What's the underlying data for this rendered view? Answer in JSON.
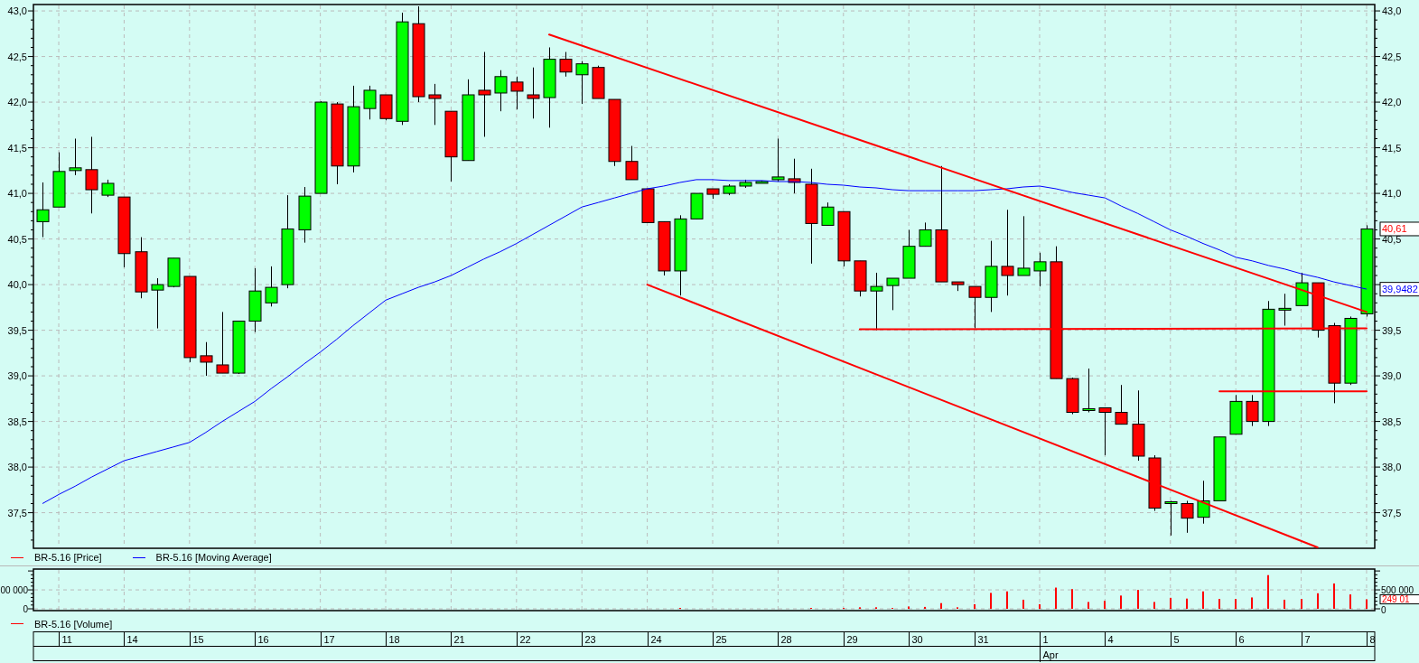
{
  "price_chart": {
    "chart_data": {
      "type": "candlestick",
      "grid": true,
      "ylim": [
        37.11,
        43.07
      ],
      "categories": [
        null,
        null,
        null,
        null,
        null,
        null,
        null,
        null,
        null,
        null,
        null,
        null,
        null,
        null,
        null,
        null,
        null,
        null,
        null,
        null,
        null,
        null,
        null,
        null,
        null,
        null,
        null,
        null,
        null,
        null,
        null,
        null,
        null,
        null,
        null,
        null,
        null,
        null,
        null,
        null,
        null,
        null,
        null,
        null,
        null,
        null,
        null,
        null,
        null,
        null,
        null,
        null,
        null,
        null,
        null,
        null,
        null,
        null,
        null,
        null,
        null,
        null,
        null,
        null,
        null,
        null,
        null,
        null,
        null,
        null,
        null,
        null,
        null,
        null,
        null,
        null,
        null,
        null,
        null,
        null,
        null,
        null
      ],
      "yticks": [
        {
          "value": 43,
          "label": "43,0"
        },
        {
          "value": 42.5,
          "label": "42,5"
        },
        {
          "value": 42,
          "label": "42,0"
        },
        {
          "value": 41.5,
          "label": "41,5"
        },
        {
          "value": 41,
          "label": "41,0"
        },
        {
          "value": 40.5,
          "label": "40,5"
        },
        {
          "value": 40,
          "label": "40,0"
        },
        {
          "value": 39.5,
          "label": "39,5"
        },
        {
          "value": 39,
          "label": "39,0"
        },
        {
          "value": 38.5,
          "label": "38,5"
        },
        {
          "value": 38,
          "label": "38,0"
        },
        {
          "value": 37.5,
          "label": "37,5"
        }
      ],
      "ohlc": [
        [
          40.69,
          41.12,
          40.52,
          40.82
        ],
        [
          40.85,
          41.45,
          40.85,
          41.24
        ],
        [
          41.25,
          41.6,
          41.2,
          41.28
        ],
        [
          41.26,
          41.62,
          40.78,
          41.04
        ],
        [
          40.98,
          41.15,
          40.96,
          41.11
        ],
        [
          40.96,
          40.96,
          40.19,
          40.34
        ],
        [
          40.36,
          40.52,
          39.85,
          39.92
        ],
        [
          39.94,
          40.07,
          39.52,
          40.0
        ],
        [
          39.98,
          40.29,
          39.97,
          40.29
        ],
        [
          40.09,
          40.09,
          39.15,
          39.2
        ],
        [
          39.22,
          39.37,
          39.0,
          39.15
        ],
        [
          39.12,
          39.7,
          39.03,
          39.03
        ],
        [
          39.03,
          39.6,
          39.02,
          39.6
        ],
        [
          39.6,
          40.18,
          39.48,
          39.93
        ],
        [
          39.8,
          40.2,
          39.76,
          39.97
        ],
        [
          40.0,
          40.98,
          39.96,
          40.61
        ],
        [
          40.6,
          41.07,
          40.46,
          40.97
        ],
        [
          41.0,
          42.01,
          41.0,
          42.0
        ],
        [
          41.98,
          42.0,
          41.1,
          41.3
        ],
        [
          41.3,
          42.18,
          41.23,
          41.95
        ],
        [
          41.93,
          42.18,
          41.81,
          42.13
        ],
        [
          42.08,
          42.08,
          41.8,
          41.82
        ],
        [
          41.79,
          42.98,
          41.75,
          42.88
        ],
        [
          42.86,
          43.05,
          42.0,
          42.06
        ],
        [
          42.08,
          42.2,
          41.75,
          42.04
        ],
        [
          41.9,
          41.9,
          41.13,
          41.4
        ],
        [
          41.36,
          42.25,
          41.36,
          42.08
        ],
        [
          42.13,
          42.55,
          41.62,
          42.08
        ],
        [
          42.1,
          42.35,
          41.9,
          42.28
        ],
        [
          42.22,
          42.28,
          41.92,
          42.12
        ],
        [
          42.08,
          42.38,
          41.82,
          42.04
        ],
        [
          42.05,
          42.6,
          41.72,
          42.47
        ],
        [
          42.47,
          42.55,
          42.28,
          42.33
        ],
        [
          42.3,
          42.45,
          41.98,
          42.42
        ],
        [
          42.38,
          42.4,
          42.04,
          42.04
        ],
        [
          42.03,
          42.03,
          41.3,
          41.35
        ],
        [
          41.35,
          41.52,
          41.15,
          41.15
        ],
        [
          41.05,
          41.05,
          40.68,
          40.68
        ],
        [
          40.69,
          40.69,
          40.1,
          40.15
        ],
        [
          40.15,
          40.76,
          39.88,
          40.72
        ],
        [
          40.72,
          41.0,
          40.72,
          41.0
        ],
        [
          41.05,
          41.05,
          40.94,
          40.99
        ],
        [
          41.0,
          41.1,
          40.98,
          41.08
        ],
        [
          41.08,
          41.15,
          41.06,
          41.12
        ],
        [
          41.13,
          41.14,
          41.12,
          41.13
        ],
        [
          41.15,
          41.6,
          41.13,
          41.18
        ],
        [
          41.16,
          41.38,
          41.0,
          41.12
        ],
        [
          41.1,
          41.27,
          40.23,
          40.67
        ],
        [
          40.65,
          40.9,
          40.65,
          40.85
        ],
        [
          40.8,
          40.8,
          40.2,
          40.26
        ],
        [
          40.26,
          40.26,
          39.87,
          39.93
        ],
        [
          39.93,
          40.13,
          39.5,
          39.98
        ],
        [
          39.99,
          40.07,
          39.72,
          40.07
        ],
        [
          40.07,
          40.6,
          40.07,
          40.42
        ],
        [
          40.42,
          40.68,
          40.42,
          40.6
        ],
        [
          40.6,
          41.3,
          40.03,
          40.03
        ],
        [
          40.03,
          40.03,
          39.93,
          40.0
        ],
        [
          39.98,
          39.98,
          39.52,
          39.86
        ],
        [
          39.86,
          40.48,
          39.7,
          40.2
        ],
        [
          40.2,
          40.82,
          39.88,
          40.1
        ],
        [
          40.1,
          40.75,
          40.1,
          40.18
        ],
        [
          40.15,
          40.35,
          39.98,
          40.25
        ],
        [
          40.25,
          40.42,
          38.97,
          38.97
        ],
        [
          38.97,
          38.98,
          38.58,
          38.6
        ],
        [
          38.62,
          39.08,
          38.6,
          38.64
        ],
        [
          38.65,
          38.65,
          38.13,
          38.6
        ],
        [
          38.6,
          38.9,
          38.47,
          38.47
        ],
        [
          38.47,
          38.84,
          38.07,
          38.12
        ],
        [
          38.1,
          38.13,
          37.52,
          37.55
        ],
        [
          37.6,
          37.63,
          37.25,
          37.62
        ],
        [
          37.6,
          37.63,
          37.28,
          37.44
        ],
        [
          37.45,
          37.85,
          37.38,
          37.63
        ],
        [
          37.63,
          38.33,
          37.63,
          38.33
        ],
        [
          38.36,
          38.79,
          38.36,
          38.72
        ],
        [
          38.72,
          38.79,
          38.45,
          38.5
        ],
        [
          38.5,
          39.82,
          38.45,
          39.73
        ],
        [
          39.73,
          39.9,
          39.55,
          39.74
        ],
        [
          39.77,
          40.13,
          39.77,
          40.02
        ],
        [
          40.02,
          40.02,
          39.42,
          39.5
        ],
        [
          39.55,
          39.58,
          38.7,
          38.92
        ],
        [
          38.92,
          39.65,
          38.9,
          39.63
        ],
        [
          39.68,
          40.65,
          39.65,
          40.61
        ]
      ],
      "series": [
        {
          "name": "BR-5.16 [Moving Average]",
          "type": "line",
          "color": "#0000ff",
          "values": [
            37.6,
            37.7,
            37.79,
            37.89,
            37.98,
            38.07,
            38.12,
            38.17,
            38.22,
            38.27,
            38.38,
            38.5,
            38.61,
            38.72,
            38.86,
            38.99,
            39.13,
            39.26,
            39.4,
            39.55,
            39.69,
            39.83,
            39.9,
            39.97,
            40.03,
            40.1,
            40.19,
            40.28,
            40.36,
            40.45,
            40.55,
            40.65,
            40.75,
            40.85,
            40.9,
            40.95,
            41.0,
            41.05,
            41.08,
            41.12,
            41.15,
            41.15,
            41.14,
            41.14,
            41.14,
            41.13,
            41.13,
            41.12,
            41.1,
            41.09,
            41.07,
            41.06,
            41.04,
            41.03,
            41.03,
            41.03,
            41.03,
            41.03,
            41.04,
            41.05,
            41.07,
            41.08,
            41.05,
            41.01,
            40.98,
            40.95,
            40.86,
            40.78,
            40.69,
            40.6,
            40.53,
            40.45,
            40.38,
            40.3,
            40.26,
            40.21,
            40.17,
            40.12,
            40.08,
            40.03,
            39.99,
            39.95
          ]
        },
        {
          "type": "line",
          "color": "#ff0000",
          "values": [
            null,
            null,
            null,
            null,
            null,
            null,
            null,
            null,
            null,
            null,
            null,
            null,
            null,
            null,
            null,
            null,
            null,
            null,
            null,
            null,
            null,
            null,
            null,
            null,
            null,
            null,
            null,
            null,
            null,
            null,
            null,
            42.74,
            null,
            null,
            null,
            null,
            null,
            null,
            null,
            null,
            null,
            null,
            null,
            null,
            null,
            null,
            null,
            null,
            null,
            null,
            null,
            null,
            null,
            null,
            null,
            null,
            null,
            null,
            null,
            null,
            null,
            null,
            null,
            null,
            null,
            null,
            null,
            null,
            null,
            null,
            null,
            null,
            null,
            null,
            null,
            null,
            null,
            null,
            null,
            null,
            null,
            39.7
          ]
        },
        {
          "type": "line",
          "color": "#ff0000",
          "values": [
            null,
            null,
            null,
            null,
            null,
            null,
            null,
            null,
            null,
            null,
            null,
            null,
            null,
            null,
            null,
            null,
            null,
            null,
            null,
            null,
            null,
            null,
            null,
            null,
            null,
            null,
            null,
            null,
            null,
            null,
            null,
            null,
            null,
            null,
            null,
            null,
            null,
            40.0,
            null,
            null,
            null,
            null,
            null,
            null,
            null,
            null,
            null,
            null,
            null,
            null,
            null,
            null,
            null,
            null,
            null,
            null,
            null,
            null,
            null,
            null,
            null,
            null,
            null,
            null,
            null,
            null,
            null,
            null,
            null,
            null,
            null,
            null,
            null,
            null,
            null,
            null,
            null,
            null,
            37.12,
            null,
            null,
            null
          ]
        },
        {
          "type": "line",
          "color": "#ff0000",
          "values": [
            null,
            null,
            null,
            null,
            null,
            null,
            null,
            null,
            null,
            null,
            null,
            null,
            null,
            null,
            null,
            null,
            null,
            null,
            null,
            null,
            null,
            null,
            null,
            null,
            null,
            null,
            null,
            null,
            null,
            null,
            null,
            null,
            null,
            null,
            null,
            null,
            null,
            null,
            null,
            null,
            null,
            null,
            null,
            null,
            null,
            null,
            null,
            null,
            null,
            null,
            39.51,
            null,
            null,
            null,
            null,
            null,
            null,
            null,
            null,
            null,
            null,
            null,
            null,
            null,
            null,
            null,
            null,
            null,
            null,
            null,
            null,
            null,
            null,
            null,
            null,
            null,
            null,
            null,
            null,
            null,
            null,
            39.52
          ]
        },
        {
          "type": "line",
          "color": "#ff0000",
          "values": [
            null,
            null,
            null,
            null,
            null,
            null,
            null,
            null,
            null,
            null,
            null,
            null,
            null,
            null,
            null,
            null,
            null,
            null,
            null,
            null,
            null,
            null,
            null,
            null,
            null,
            null,
            null,
            null,
            null,
            null,
            null,
            null,
            null,
            null,
            null,
            null,
            null,
            null,
            null,
            null,
            null,
            null,
            null,
            null,
            null,
            null,
            null,
            null,
            null,
            null,
            null,
            null,
            null,
            null,
            null,
            null,
            null,
            null,
            null,
            null,
            null,
            null,
            null,
            null,
            null,
            null,
            null,
            null,
            null,
            null,
            null,
            null,
            38.83,
            null,
            null,
            null,
            null,
            null,
            null,
            null,
            null,
            38.83
          ]
        }
      ]
    },
    "right_axis_labels": [
      "43,0",
      "42,5",
      "42,0",
      "41,5",
      "41,0",
      "40,5",
      "39,5",
      "39,0",
      "38,5",
      "38,0",
      "37,5"
    ],
    "price_tags": [
      {
        "label": "40,61",
        "color": "#ff0000"
      },
      {
        "label": "39,9482",
        "color": "#0000ff"
      }
    ],
    "legend": [
      {
        "label": "BR-5.16 [Price]",
        "color": "#ff0000"
      }
    ]
  },
  "volume_chart": {
    "chart_data": {
      "type": "bar",
      "grid": true,
      "ylim": [
        0,
        1050000
      ],
      "yticks": [
        {
          "value": 500000,
          "label": "500 000"
        },
        {
          "value": 0,
          "label": "0"
        }
      ],
      "categories": [
        null,
        null,
        null,
        null,
        null,
        null,
        null,
        null,
        null,
        null,
        null,
        null,
        null,
        null,
        null,
        null,
        null,
        null,
        null,
        null,
        null,
        null,
        null,
        null,
        null,
        null,
        null,
        null,
        null,
        null,
        null,
        null,
        null,
        null,
        null,
        null,
        null,
        null,
        null,
        null,
        null,
        null,
        null,
        null,
        null,
        null,
        null,
        null,
        null,
        null,
        null,
        null,
        null,
        null,
        null,
        null,
        null,
        null,
        null,
        null,
        null,
        null,
        null,
        null,
        null,
        null,
        null,
        null,
        null,
        null,
        null,
        null,
        null,
        null,
        null,
        null,
        null,
        null,
        null,
        null,
        null,
        null
      ],
      "series": [
        {
          "name": "BR-5.16 [Volume]",
          "color": "#ff0000",
          "values": [
            null,
            null,
            null,
            null,
            null,
            null,
            null,
            null,
            null,
            null,
            null,
            null,
            null,
            null,
            null,
            null,
            null,
            null,
            null,
            null,
            null,
            null,
            null,
            null,
            null,
            null,
            null,
            null,
            null,
            null,
            null,
            null,
            null,
            null,
            null,
            null,
            null,
            null,
            null,
            20000,
            null,
            null,
            null,
            null,
            null,
            null,
            null,
            10000,
            null,
            10000,
            40000,
            40000,
            20000,
            60000,
            50000,
            150000,
            40000,
            120000,
            420000,
            460000,
            240000,
            120000,
            560000,
            520000,
            180000,
            210000,
            350000,
            500000,
            180000,
            290000,
            270000,
            460000,
            260000,
            260000,
            300000,
            890000,
            240000,
            260000,
            410000,
            670000,
            380000,
            250000
          ]
        }
      ]
    },
    "left_axis_labels": [
      "00 000",
      "0"
    ],
    "value_tag": {
      "label": "249 01",
      "color": "#ff0000"
    }
  },
  "date_axis": {
    "days": [
      {
        "label": "11"
      },
      {
        "label": "14"
      },
      {
        "label": "15"
      },
      {
        "label": "16"
      },
      {
        "label": "17"
      },
      {
        "label": "18"
      },
      {
        "label": "21"
      },
      {
        "label": "22"
      },
      {
        "label": "23"
      },
      {
        "label": "24"
      },
      {
        "label": "25"
      },
      {
        "label": "28"
      },
      {
        "label": "29"
      },
      {
        "label": "30"
      },
      {
        "label": "31"
      },
      {
        "label": "1",
        "month": "Apr"
      },
      {
        "label": "4"
      },
      {
        "label": "5"
      },
      {
        "label": "6"
      },
      {
        "label": "7"
      },
      {
        "label": "8"
      }
    ]
  }
}
